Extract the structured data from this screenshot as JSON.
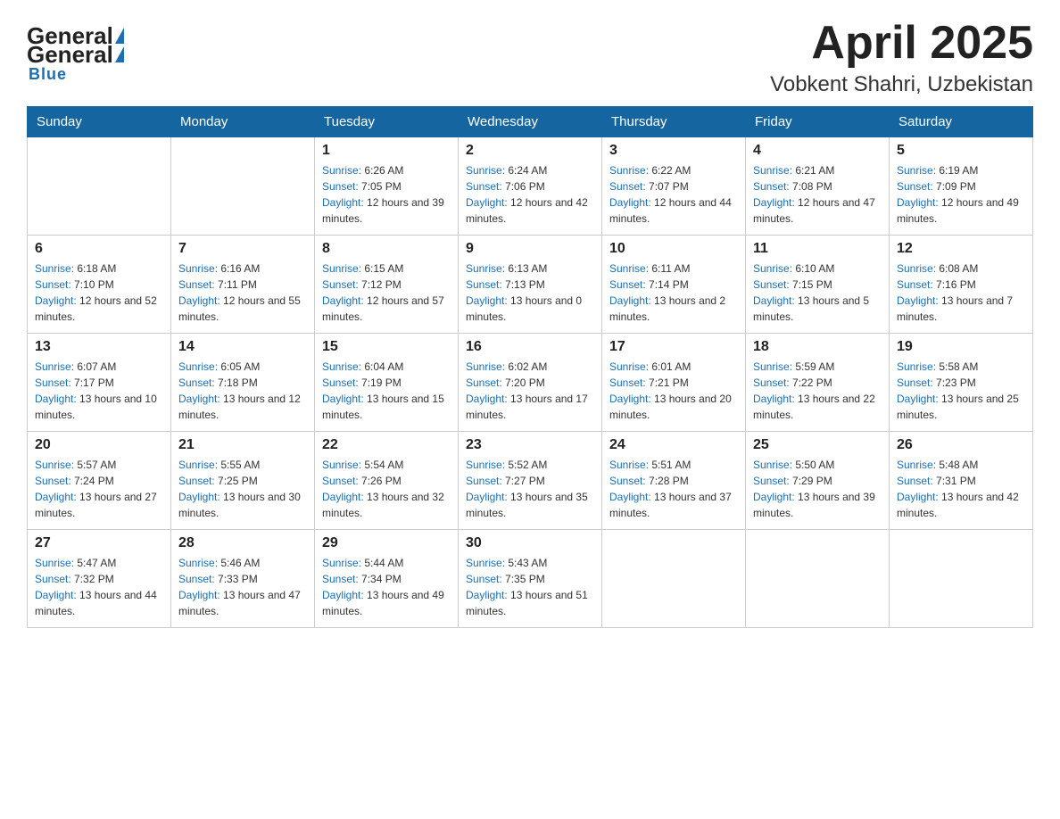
{
  "header": {
    "logo_general": "General",
    "logo_blue": "Blue",
    "title": "April 2025",
    "subtitle": "Vobkent Shahri, Uzbekistan"
  },
  "days_of_week": [
    "Sunday",
    "Monday",
    "Tuesday",
    "Wednesday",
    "Thursday",
    "Friday",
    "Saturday"
  ],
  "weeks": [
    [
      {
        "day": "",
        "sunrise": "",
        "sunset": "",
        "daylight": ""
      },
      {
        "day": "",
        "sunrise": "",
        "sunset": "",
        "daylight": ""
      },
      {
        "day": "1",
        "sunrise": "6:26 AM",
        "sunset": "7:05 PM",
        "daylight": "12 hours and 39 minutes."
      },
      {
        "day": "2",
        "sunrise": "6:24 AM",
        "sunset": "7:06 PM",
        "daylight": "12 hours and 42 minutes."
      },
      {
        "day": "3",
        "sunrise": "6:22 AM",
        "sunset": "7:07 PM",
        "daylight": "12 hours and 44 minutes."
      },
      {
        "day": "4",
        "sunrise": "6:21 AM",
        "sunset": "7:08 PM",
        "daylight": "12 hours and 47 minutes."
      },
      {
        "day": "5",
        "sunrise": "6:19 AM",
        "sunset": "7:09 PM",
        "daylight": "12 hours and 49 minutes."
      }
    ],
    [
      {
        "day": "6",
        "sunrise": "6:18 AM",
        "sunset": "7:10 PM",
        "daylight": "12 hours and 52 minutes."
      },
      {
        "day": "7",
        "sunrise": "6:16 AM",
        "sunset": "7:11 PM",
        "daylight": "12 hours and 55 minutes."
      },
      {
        "day": "8",
        "sunrise": "6:15 AM",
        "sunset": "7:12 PM",
        "daylight": "12 hours and 57 minutes."
      },
      {
        "day": "9",
        "sunrise": "6:13 AM",
        "sunset": "7:13 PM",
        "daylight": "13 hours and 0 minutes."
      },
      {
        "day": "10",
        "sunrise": "6:11 AM",
        "sunset": "7:14 PM",
        "daylight": "13 hours and 2 minutes."
      },
      {
        "day": "11",
        "sunrise": "6:10 AM",
        "sunset": "7:15 PM",
        "daylight": "13 hours and 5 minutes."
      },
      {
        "day": "12",
        "sunrise": "6:08 AM",
        "sunset": "7:16 PM",
        "daylight": "13 hours and 7 minutes."
      }
    ],
    [
      {
        "day": "13",
        "sunrise": "6:07 AM",
        "sunset": "7:17 PM",
        "daylight": "13 hours and 10 minutes."
      },
      {
        "day": "14",
        "sunrise": "6:05 AM",
        "sunset": "7:18 PM",
        "daylight": "13 hours and 12 minutes."
      },
      {
        "day": "15",
        "sunrise": "6:04 AM",
        "sunset": "7:19 PM",
        "daylight": "13 hours and 15 minutes."
      },
      {
        "day": "16",
        "sunrise": "6:02 AM",
        "sunset": "7:20 PM",
        "daylight": "13 hours and 17 minutes."
      },
      {
        "day": "17",
        "sunrise": "6:01 AM",
        "sunset": "7:21 PM",
        "daylight": "13 hours and 20 minutes."
      },
      {
        "day": "18",
        "sunrise": "5:59 AM",
        "sunset": "7:22 PM",
        "daylight": "13 hours and 22 minutes."
      },
      {
        "day": "19",
        "sunrise": "5:58 AM",
        "sunset": "7:23 PM",
        "daylight": "13 hours and 25 minutes."
      }
    ],
    [
      {
        "day": "20",
        "sunrise": "5:57 AM",
        "sunset": "7:24 PM",
        "daylight": "13 hours and 27 minutes."
      },
      {
        "day": "21",
        "sunrise": "5:55 AM",
        "sunset": "7:25 PM",
        "daylight": "13 hours and 30 minutes."
      },
      {
        "day": "22",
        "sunrise": "5:54 AM",
        "sunset": "7:26 PM",
        "daylight": "13 hours and 32 minutes."
      },
      {
        "day": "23",
        "sunrise": "5:52 AM",
        "sunset": "7:27 PM",
        "daylight": "13 hours and 35 minutes."
      },
      {
        "day": "24",
        "sunrise": "5:51 AM",
        "sunset": "7:28 PM",
        "daylight": "13 hours and 37 minutes."
      },
      {
        "day": "25",
        "sunrise": "5:50 AM",
        "sunset": "7:29 PM",
        "daylight": "13 hours and 39 minutes."
      },
      {
        "day": "26",
        "sunrise": "5:48 AM",
        "sunset": "7:31 PM",
        "daylight": "13 hours and 42 minutes."
      }
    ],
    [
      {
        "day": "27",
        "sunrise": "5:47 AM",
        "sunset": "7:32 PM",
        "daylight": "13 hours and 44 minutes."
      },
      {
        "day": "28",
        "sunrise": "5:46 AM",
        "sunset": "7:33 PM",
        "daylight": "13 hours and 47 minutes."
      },
      {
        "day": "29",
        "sunrise": "5:44 AM",
        "sunset": "7:34 PM",
        "daylight": "13 hours and 49 minutes."
      },
      {
        "day": "30",
        "sunrise": "5:43 AM",
        "sunset": "7:35 PM",
        "daylight": "13 hours and 51 minutes."
      },
      {
        "day": "",
        "sunrise": "",
        "sunset": "",
        "daylight": ""
      },
      {
        "day": "",
        "sunrise": "",
        "sunset": "",
        "daylight": ""
      },
      {
        "day": "",
        "sunrise": "",
        "sunset": "",
        "daylight": ""
      }
    ]
  ],
  "labels": {
    "sunrise": "Sunrise: ",
    "sunset": "Sunset: ",
    "daylight": "Daylight: "
  }
}
